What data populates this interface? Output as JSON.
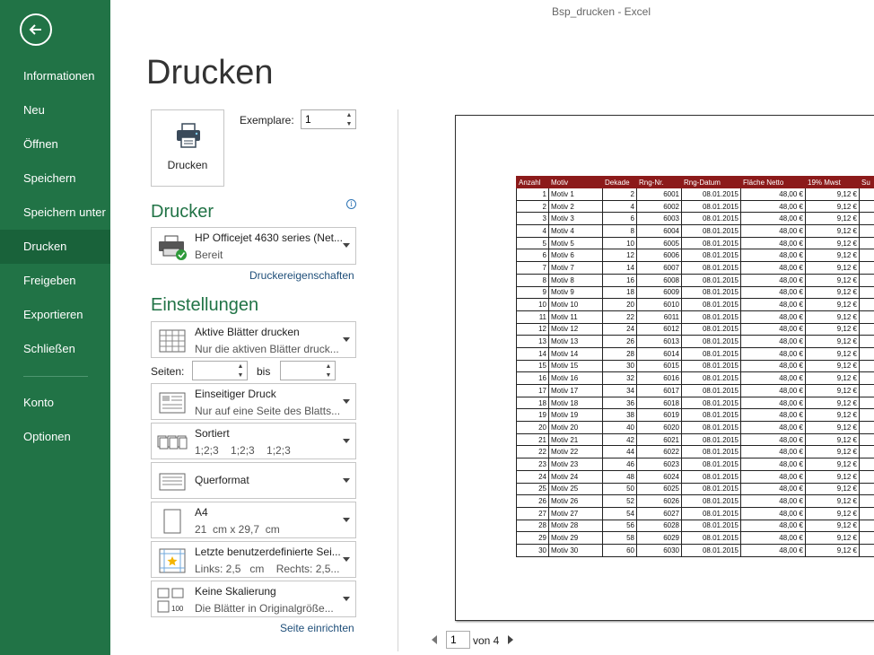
{
  "window": {
    "title": "Bsp_drucken - Excel"
  },
  "sidebar": {
    "items": [
      {
        "label": "Informationen"
      },
      {
        "label": "Neu"
      },
      {
        "label": "Öffnen"
      },
      {
        "label": "Speichern"
      },
      {
        "label": "Speichern unter"
      },
      {
        "label": "Drucken",
        "active": true
      },
      {
        "label": "Freigeben"
      },
      {
        "label": "Exportieren"
      },
      {
        "label": "Schließen"
      },
      {
        "label": "Konto"
      },
      {
        "label": "Optionen"
      }
    ],
    "colors": {
      "background": "#217346",
      "active": "#19623a"
    }
  },
  "page": {
    "title": "Drucken"
  },
  "print": {
    "button_label": "Drucken",
    "copies_label": "Exemplare:",
    "copies_value": "1"
  },
  "printer": {
    "section_title": "Drucker",
    "name": "HP Officejet 4630 series (Net...",
    "status": "Bereit",
    "properties_link": "Druckereigenschaften"
  },
  "settings": {
    "section_title": "Einstellungen",
    "scope": {
      "title": "Aktive Blätter drucken",
      "subtitle": "Nur die aktiven Blätter druck..."
    },
    "pages": {
      "label": "Seiten:",
      "to_label": "bis",
      "from": "",
      "to": ""
    },
    "sides": {
      "title": "Einseitiger Druck",
      "subtitle": "Nur auf eine Seite des Blatts..."
    },
    "collation": {
      "title": "Sortiert",
      "subtitle": "1;2;3    1;2;3    1;2;3"
    },
    "orientation": {
      "title": "Querformat"
    },
    "paper": {
      "title": "A4",
      "subtitle": "21  cm x 29,7  cm"
    },
    "margins": {
      "title": "Letzte benutzerdefinierte Sei...",
      "subtitle": "Links: 2,5   cm    Rechts: 2,5..."
    },
    "scaling": {
      "title": "Keine Skalierung",
      "subtitle": "Die Blätter in Originalgröße..."
    },
    "page_setup_link": "Seite einrichten"
  },
  "preview": {
    "headers": [
      "Anzahl",
      "Motiv",
      "Dekade",
      "Rng-Nr.",
      "Rng-Datum",
      "Fläche Netto",
      "19% Mwst",
      "Su"
    ],
    "header_color": "#8c1a1a",
    "rows": [
      [
        "1",
        "Motiv 1",
        "2",
        "6001",
        "08.01.2015",
        "48,00 €",
        "9,12 €"
      ],
      [
        "2",
        "Motiv 2",
        "4",
        "6002",
        "08.01.2015",
        "48,00 €",
        "9,12 €"
      ],
      [
        "3",
        "Motiv 3",
        "6",
        "6003",
        "08.01.2015",
        "48,00 €",
        "9,12 €"
      ],
      [
        "4",
        "Motiv 4",
        "8",
        "6004",
        "08.01.2015",
        "48,00 €",
        "9,12 €"
      ],
      [
        "5",
        "Motiv 5",
        "10",
        "6005",
        "08.01.2015",
        "48,00 €",
        "9,12 €"
      ],
      [
        "6",
        "Motiv 6",
        "12",
        "6006",
        "08.01.2015",
        "48,00 €",
        "9,12 €"
      ],
      [
        "7",
        "Motiv 7",
        "14",
        "6007",
        "08.01.2015",
        "48,00 €",
        "9,12 €"
      ],
      [
        "8",
        "Motiv 8",
        "16",
        "6008",
        "08.01.2015",
        "48,00 €",
        "9,12 €"
      ],
      [
        "9",
        "Motiv 9",
        "18",
        "6009",
        "08.01.2015",
        "48,00 €",
        "9,12 €"
      ],
      [
        "10",
        "Motiv 10",
        "20",
        "6010",
        "08.01.2015",
        "48,00 €",
        "9,12 €"
      ],
      [
        "11",
        "Motiv 11",
        "22",
        "6011",
        "08.01.2015",
        "48,00 €",
        "9,12 €"
      ],
      [
        "12",
        "Motiv 12",
        "24",
        "6012",
        "08.01.2015",
        "48,00 €",
        "9,12 €"
      ],
      [
        "13",
        "Motiv 13",
        "26",
        "6013",
        "08.01.2015",
        "48,00 €",
        "9,12 €"
      ],
      [
        "14",
        "Motiv 14",
        "28",
        "6014",
        "08.01.2015",
        "48,00 €",
        "9,12 €"
      ],
      [
        "15",
        "Motiv 15",
        "30",
        "6015",
        "08.01.2015",
        "48,00 €",
        "9,12 €"
      ],
      [
        "16",
        "Motiv 16",
        "32",
        "6016",
        "08.01.2015",
        "48,00 €",
        "9,12 €"
      ],
      [
        "17",
        "Motiv 17",
        "34",
        "6017",
        "08.01.2015",
        "48,00 €",
        "9,12 €"
      ],
      [
        "18",
        "Motiv 18",
        "36",
        "6018",
        "08.01.2015",
        "48,00 €",
        "9,12 €"
      ],
      [
        "19",
        "Motiv 19",
        "38",
        "6019",
        "08.01.2015",
        "48,00 €",
        "9,12 €"
      ],
      [
        "20",
        "Motiv 20",
        "40",
        "6020",
        "08.01.2015",
        "48,00 €",
        "9,12 €"
      ],
      [
        "21",
        "Motiv 21",
        "42",
        "6021",
        "08.01.2015",
        "48,00 €",
        "9,12 €"
      ],
      [
        "22",
        "Motiv 22",
        "44",
        "6022",
        "08.01.2015",
        "48,00 €",
        "9,12 €"
      ],
      [
        "23",
        "Motiv 23",
        "46",
        "6023",
        "08.01.2015",
        "48,00 €",
        "9,12 €"
      ],
      [
        "24",
        "Motiv 24",
        "48",
        "6024",
        "08.01.2015",
        "48,00 €",
        "9,12 €"
      ],
      [
        "25",
        "Motiv 25",
        "50",
        "6025",
        "08.01.2015",
        "48,00 €",
        "9,12 €"
      ],
      [
        "26",
        "Motiv 26",
        "52",
        "6026",
        "08.01.2015",
        "48,00 €",
        "9,12 €"
      ],
      [
        "27",
        "Motiv 27",
        "54",
        "6027",
        "08.01.2015",
        "48,00 €",
        "9,12 €"
      ],
      [
        "28",
        "Motiv 28",
        "56",
        "6028",
        "08.01.2015",
        "48,00 €",
        "9,12 €"
      ],
      [
        "29",
        "Motiv 29",
        "58",
        "6029",
        "08.01.2015",
        "48,00 €",
        "9,12 €"
      ],
      [
        "30",
        "Motiv 30",
        "60",
        "6030",
        "08.01.2015",
        "48,00 €",
        "9,12 €"
      ]
    ]
  },
  "pager": {
    "current": "1",
    "of_label": "von 4"
  }
}
